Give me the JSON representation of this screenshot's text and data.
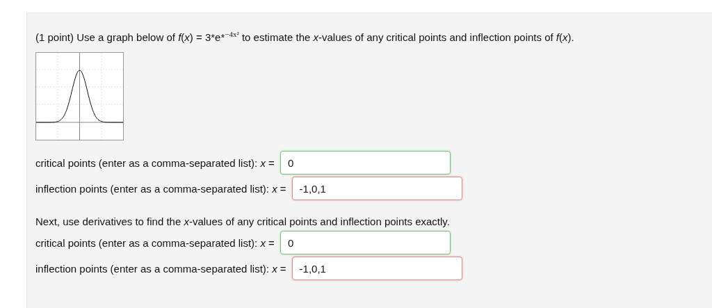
{
  "prompt": "(1 point) Use a graph below of *f*(*x*) = 3*e*$^{−4x²}$ to estimate the *x*-values of any critical points and inflection points of *f*(*x*).",
  "part1": {
    "answers": [
      {
        "label": "critical points (enter as a comma-separated list): *x* =",
        "value": "0",
        "correct": true
      },
      {
        "label": "inflection points (enter as a comma-separated list): *x* =",
        "value": "-1,0,1",
        "correct": false
      }
    ]
  },
  "part2": {
    "intro": "Next, use derivatives to find the *x*-values of any critical points and inflection points exactly.",
    "answers": [
      {
        "label": "critical points (enter as a comma-separated list): *x* =",
        "value": "0",
        "correct": true
      },
      {
        "label": "inflection points (enter as a comma-separated list): *x* =",
        "value": "-1,0,1",
        "correct": false
      }
    ]
  }
}
